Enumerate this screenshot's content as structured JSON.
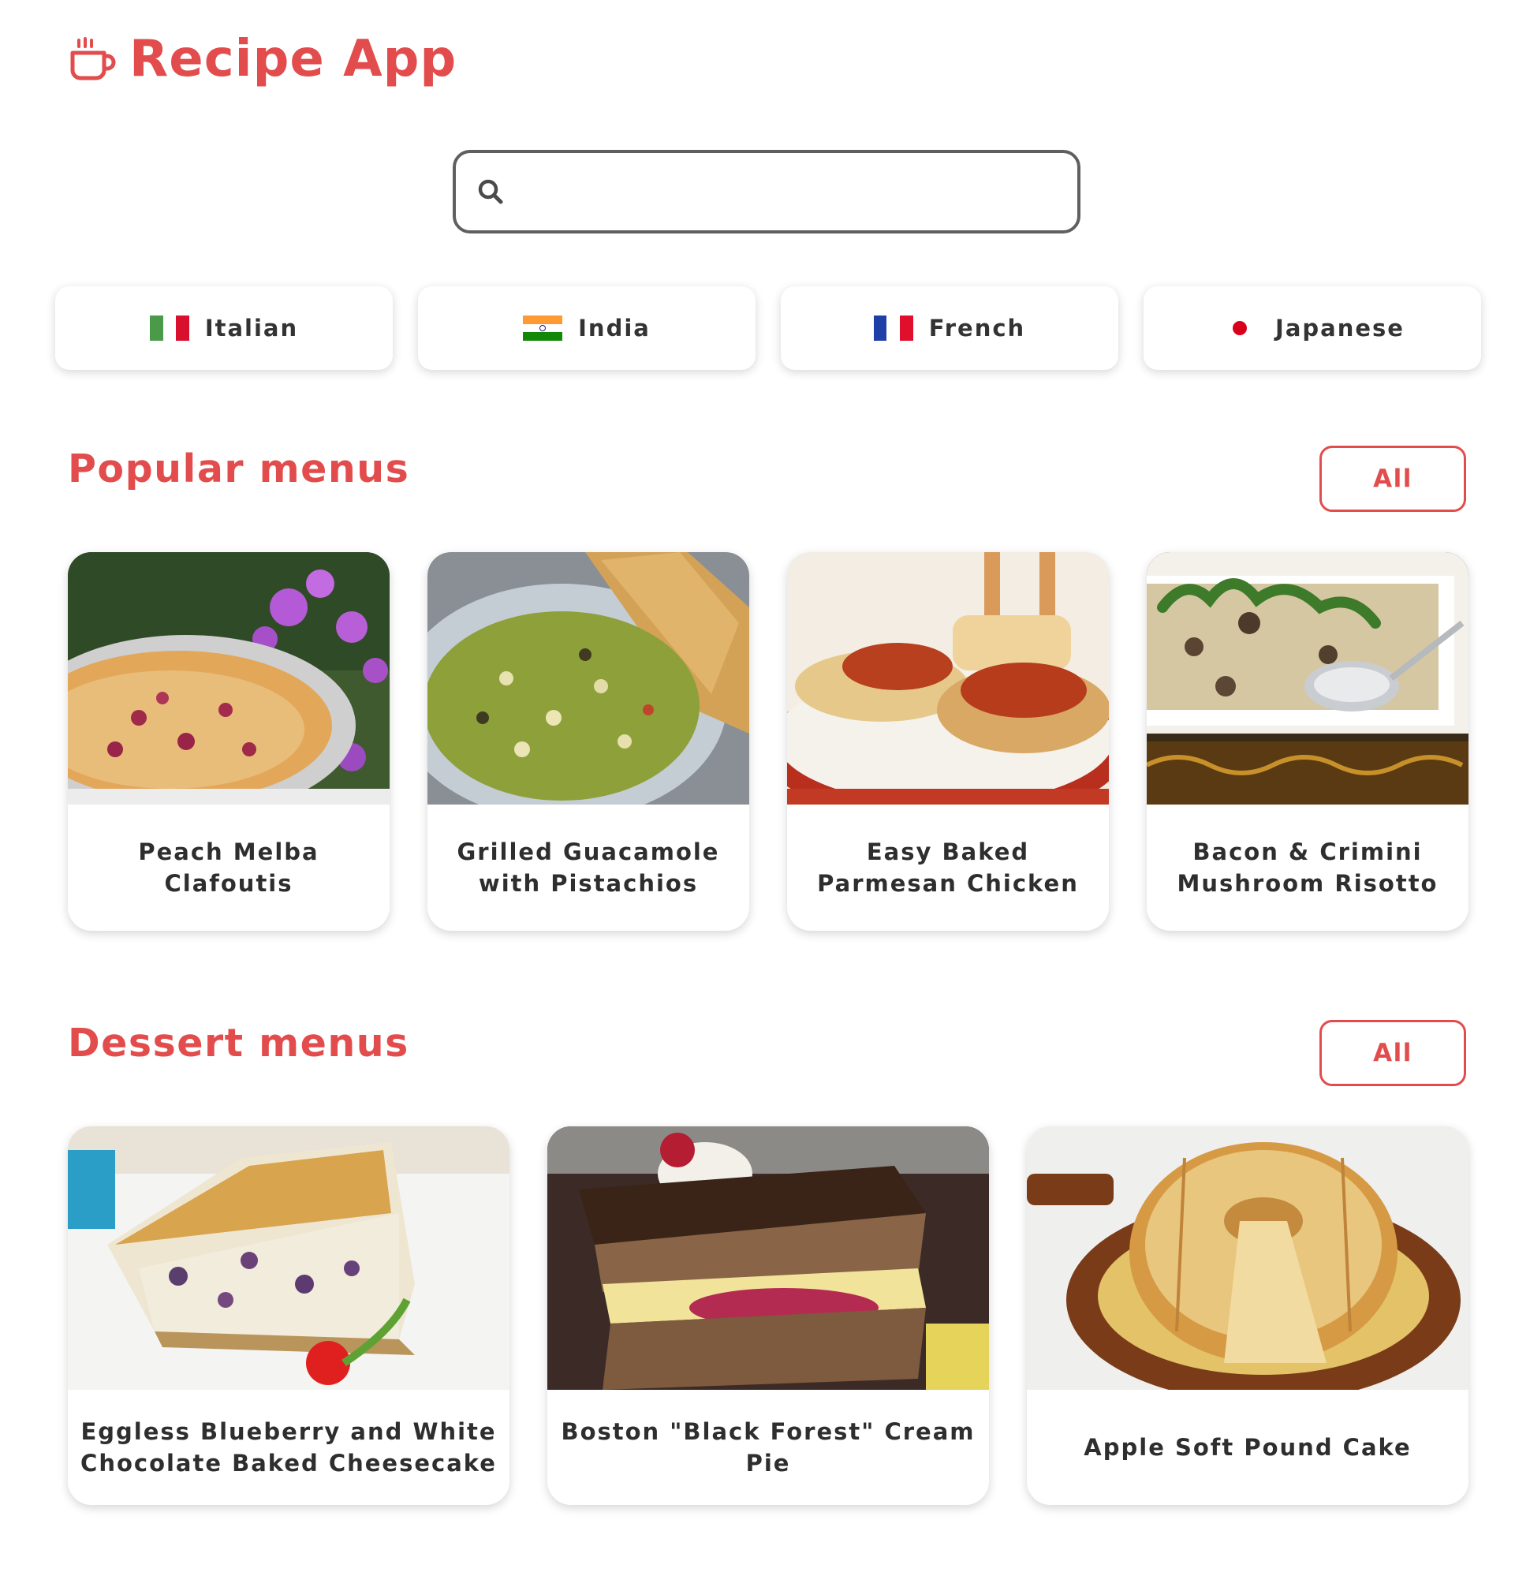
{
  "app": {
    "title": "Recipe App",
    "logo_icon": "coffee-cup-icon",
    "brand_color": "#e24c4c"
  },
  "search": {
    "icon": "search-icon",
    "value": "",
    "placeholder": ""
  },
  "cuisines": [
    {
      "label": "Italian",
      "flag": "italy-flag-icon"
    },
    {
      "label": "India",
      "flag": "india-flag-icon"
    },
    {
      "label": "French",
      "flag": "france-flag-icon"
    },
    {
      "label": "Japanese",
      "flag": "japan-flag-icon"
    }
  ],
  "popular": {
    "heading": "Popular menus",
    "all_label": "All",
    "items": [
      {
        "title": "Peach Melba Clafoutis"
      },
      {
        "title": "Grilled Guacamole with Pistachios"
      },
      {
        "title": "Easy Baked Parmesan Chicken"
      },
      {
        "title": "Bacon & Crimini Mushroom Risotto"
      }
    ]
  },
  "dessert": {
    "heading": "Dessert menus",
    "all_label": "All",
    "items": [
      {
        "title": "Eggless Blueberry and White Chocolate Baked Cheesecake"
      },
      {
        "title": "Boston \"Black Forest\" Cream Pie"
      },
      {
        "title": "Apple Soft Pound Cake"
      }
    ]
  }
}
